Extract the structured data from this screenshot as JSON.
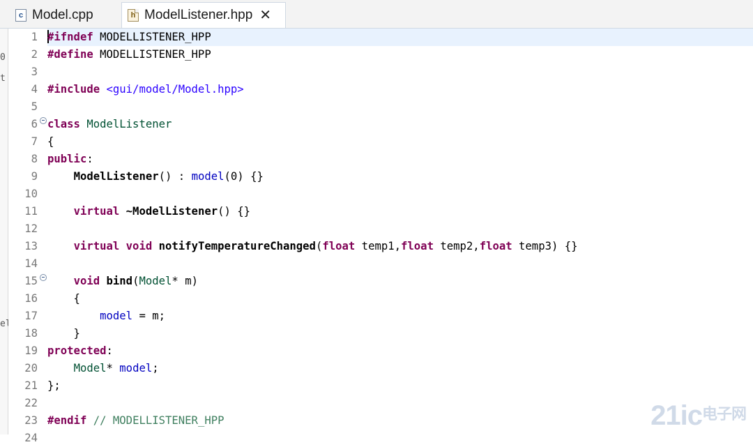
{
  "tabs": [
    {
      "label": "Model.cpp",
      "icon": "c-source-file-icon",
      "active": false
    },
    {
      "label": "ModelListener.hpp",
      "icon": "header-file-icon",
      "active": true
    }
  ],
  "left_edge_marks": [
    "0",
    "t",
    "el"
  ],
  "code": {
    "lines": [
      {
        "n": "1",
        "tokens": [
          {
            "t": "#ifndef",
            "c": "pp"
          },
          {
            "t": " MODELLISTENER_HPP",
            "c": "macro"
          }
        ]
      },
      {
        "n": "2",
        "tokens": [
          {
            "t": "#define",
            "c": "pp"
          },
          {
            "t": " MODELLISTENER_HPP",
            "c": "macro"
          }
        ]
      },
      {
        "n": "3",
        "tokens": []
      },
      {
        "n": "4",
        "tokens": [
          {
            "t": "#include",
            "c": "pp"
          },
          {
            "t": " <gui/model/Model.hpp>",
            "c": "str"
          }
        ]
      },
      {
        "n": "5",
        "tokens": []
      },
      {
        "n": "6",
        "tokens": [
          {
            "t": "class",
            "c": "kw"
          },
          {
            "t": " ",
            "c": ""
          },
          {
            "t": "ModelListener",
            "c": "cls"
          }
        ]
      },
      {
        "n": "7",
        "tokens": [
          {
            "t": "{",
            "c": ""
          }
        ]
      },
      {
        "n": "8",
        "tokens": [
          {
            "t": "public",
            "c": "kw"
          },
          {
            "t": ":",
            "c": ""
          }
        ]
      },
      {
        "n": "9",
        "tokens": [
          {
            "t": "    ",
            "c": ""
          },
          {
            "t": "ModelListener",
            "c": "fn"
          },
          {
            "t": "() : ",
            "c": ""
          },
          {
            "t": "model",
            "c": "fld"
          },
          {
            "t": "(0) {}",
            "c": ""
          }
        ]
      },
      {
        "n": "10",
        "tokens": []
      },
      {
        "n": "11",
        "tokens": [
          {
            "t": "    ",
            "c": ""
          },
          {
            "t": "virtual",
            "c": "kw"
          },
          {
            "t": " ",
            "c": ""
          },
          {
            "t": "~ModelListener",
            "c": "fn"
          },
          {
            "t": "() {}",
            "c": ""
          }
        ]
      },
      {
        "n": "12",
        "tokens": []
      },
      {
        "n": "13",
        "tokens": [
          {
            "t": "    ",
            "c": ""
          },
          {
            "t": "virtual",
            "c": "kw"
          },
          {
            "t": " ",
            "c": ""
          },
          {
            "t": "void",
            "c": "kw"
          },
          {
            "t": " ",
            "c": ""
          },
          {
            "t": "notifyTemperatureChanged",
            "c": "fn"
          },
          {
            "t": "(",
            "c": ""
          },
          {
            "t": "float",
            "c": "kw"
          },
          {
            "t": " temp1,",
            "c": ""
          },
          {
            "t": "float",
            "c": "kw"
          },
          {
            "t": " temp2,",
            "c": ""
          },
          {
            "t": "float",
            "c": "kw"
          },
          {
            "t": " temp3) {}",
            "c": ""
          }
        ]
      },
      {
        "n": "14",
        "tokens": []
      },
      {
        "n": "15",
        "tokens": [
          {
            "t": "    ",
            "c": ""
          },
          {
            "t": "void",
            "c": "kw"
          },
          {
            "t": " ",
            "c": ""
          },
          {
            "t": "bind",
            "c": "fn"
          },
          {
            "t": "(",
            "c": ""
          },
          {
            "t": "Model",
            "c": "cls"
          },
          {
            "t": "* m)",
            "c": ""
          }
        ]
      },
      {
        "n": "16",
        "tokens": [
          {
            "t": "    {",
            "c": ""
          }
        ]
      },
      {
        "n": "17",
        "tokens": [
          {
            "t": "        ",
            "c": ""
          },
          {
            "t": "model",
            "c": "fld"
          },
          {
            "t": " = m;",
            "c": ""
          }
        ]
      },
      {
        "n": "18",
        "tokens": [
          {
            "t": "    }",
            "c": ""
          }
        ]
      },
      {
        "n": "19",
        "tokens": [
          {
            "t": "protected",
            "c": "kw"
          },
          {
            "t": ":",
            "c": ""
          }
        ]
      },
      {
        "n": "20",
        "tokens": [
          {
            "t": "    ",
            "c": ""
          },
          {
            "t": "Model",
            "c": "cls"
          },
          {
            "t": "* ",
            "c": ""
          },
          {
            "t": "model",
            "c": "fld"
          },
          {
            "t": ";",
            "c": ""
          }
        ]
      },
      {
        "n": "21",
        "tokens": [
          {
            "t": "};",
            "c": ""
          }
        ]
      },
      {
        "n": "22",
        "tokens": []
      },
      {
        "n": "23",
        "tokens": [
          {
            "t": "#endif",
            "c": "pp"
          },
          {
            "t": " ",
            "c": ""
          },
          {
            "t": "// MODELLISTENER_HPP",
            "c": "cmt"
          }
        ]
      },
      {
        "n": "24",
        "tokens": []
      }
    ],
    "fold_lines": [
      "6",
      "15"
    ],
    "current_line": "1"
  },
  "watermark": {
    "latin": "21ic",
    "cn": "电子网"
  },
  "colors": {
    "keyword": "#7f0055",
    "string": "#2a00ff",
    "class": "#005032",
    "field": "#0000c0",
    "comment": "#3f7f5f",
    "current_line": "#e8f2fe"
  }
}
